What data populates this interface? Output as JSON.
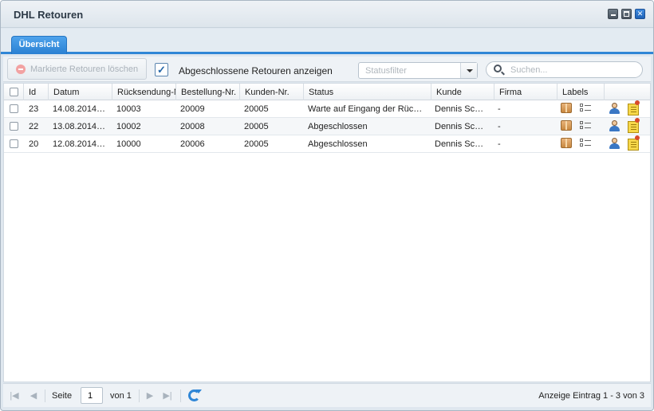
{
  "window": {
    "title": "DHL Retouren"
  },
  "tabs": [
    {
      "label": "Übersicht",
      "active": true
    }
  ],
  "toolbar": {
    "delete_label": "Markierte Retouren löschen",
    "show_closed_label": "Abgeschlossene Retouren anzeigen",
    "show_closed_checked": true,
    "checkmark": "✓",
    "status_filter_placeholder": "Statusfilter",
    "search_placeholder": "Suchen..."
  },
  "table": {
    "columns": [
      "Id",
      "Datum",
      "Rücksendung-Nr.",
      "Bestellung-Nr.",
      "Kunden-Nr.",
      "Status",
      "Kunde",
      "Firma",
      "Labels"
    ],
    "rows": [
      {
        "id": "23",
        "datum": "14.08.2014…",
        "ruecksendung": "10003",
        "bestellung": "20009",
        "kunden_nr": "20005",
        "status": "Warte auf Eingang der Rüc…",
        "kunde": "Dennis Sc…",
        "firma": "-"
      },
      {
        "id": "22",
        "datum": "13.08.2014…",
        "ruecksendung": "10002",
        "bestellung": "20008",
        "kunden_nr": "20005",
        "status": "Abgeschlossen",
        "kunde": "Dennis Sc…",
        "firma": "-"
      },
      {
        "id": "20",
        "datum": "12.08.2014…",
        "ruecksendung": "10000",
        "bestellung": "20006",
        "kunden_nr": "20005",
        "status": "Abgeschlossen",
        "kunde": "Dennis Sc…",
        "firma": "-"
      }
    ]
  },
  "pager": {
    "page_label": "Seite",
    "page_value": "1",
    "of_label": "von 1",
    "summary": "Anzeige Eintrag 1 - 3 von 3"
  },
  "icons": [
    "minimize-icon",
    "maximize-icon",
    "close-icon",
    "delete-icon",
    "search-icon",
    "dropdown-arrow-icon",
    "package-icon",
    "checklist-icon",
    "user-icon",
    "note-icon",
    "first-page-icon",
    "prev-page-icon",
    "next-page-icon",
    "last-page-icon",
    "refresh-icon"
  ],
  "colors": {
    "accent": "#2f86d6",
    "window_bg": "#dfe7ef"
  }
}
